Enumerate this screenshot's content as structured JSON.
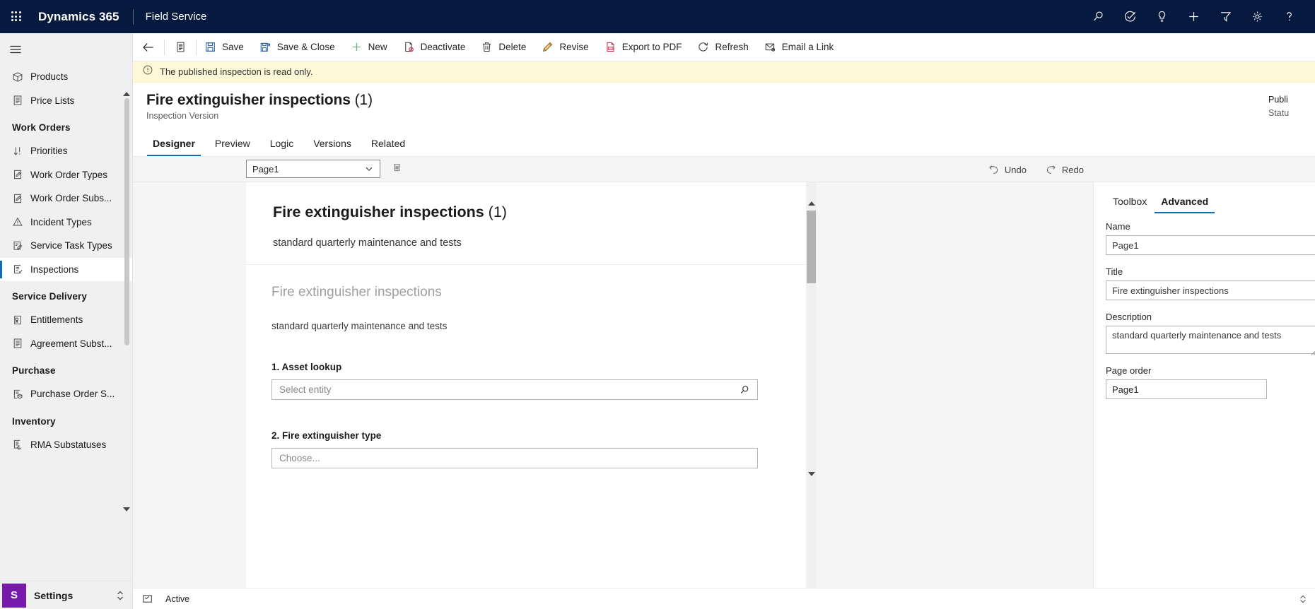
{
  "topnav": {
    "waffle_icon": "waffle-grid-icon",
    "brand": "Dynamics 365",
    "app_name": "Field Service",
    "icons": [
      {
        "name": "search-icon",
        "label": "Search"
      },
      {
        "name": "diagnostics-icon",
        "label": "Diagnostics"
      },
      {
        "name": "lightbulb-icon",
        "label": "Ideas"
      },
      {
        "name": "plus-icon",
        "label": "Quick create"
      },
      {
        "name": "filter-icon",
        "label": "Filter"
      },
      {
        "name": "gear-icon",
        "label": "Settings"
      },
      {
        "name": "help-icon",
        "label": "Help"
      }
    ]
  },
  "sitemap": {
    "hamburger_icon": "hamburger-icon",
    "groups": [
      {
        "title": "",
        "items": [
          {
            "label": "Products",
            "icon": "box-icon",
            "selected": false
          },
          {
            "label": "Price Lists",
            "icon": "pricelist-icon",
            "selected": false
          }
        ]
      },
      {
        "title": "Work Orders",
        "items": [
          {
            "label": "Priorities",
            "icon": "sort-icon",
            "selected": false
          },
          {
            "label": "Work Order Types",
            "icon": "clipboard-pen-icon",
            "selected": false
          },
          {
            "label": "Work Order Subs...",
            "icon": "clipboard-pen-icon",
            "selected": false
          },
          {
            "label": "Incident Types",
            "icon": "warning-triangle-icon",
            "selected": false
          },
          {
            "label": "Service Task Types",
            "icon": "task-pen-icon",
            "selected": false
          },
          {
            "label": "Inspections",
            "icon": "inspection-icon",
            "selected": true
          }
        ]
      },
      {
        "title": "Service Delivery",
        "items": [
          {
            "label": "Entitlements",
            "icon": "entitlement-icon",
            "selected": false
          },
          {
            "label": "Agreement Subst...",
            "icon": "pricelist-icon",
            "selected": false
          }
        ]
      },
      {
        "title": "Purchase",
        "items": [
          {
            "label": "Purchase Order S...",
            "icon": "purchase-order-icon",
            "selected": false
          }
        ]
      },
      {
        "title": "Inventory",
        "items": [
          {
            "label": "RMA Substatuses",
            "icon": "rma-icon",
            "selected": false
          }
        ]
      }
    ],
    "settings": {
      "tile_letter": "S",
      "label": "Settings",
      "chevron_icon": "chevron-updown-icon"
    }
  },
  "commandbar": {
    "back_icon": "arrow-left-icon",
    "form_selector_icon": "form-list-icon",
    "buttons": [
      {
        "label": "Save",
        "icon": "save-icon"
      },
      {
        "label": "Save & Close",
        "icon": "save-close-icon"
      },
      {
        "label": "New",
        "icon": "plus-icon"
      },
      {
        "label": "Deactivate",
        "icon": "deactivate-icon"
      },
      {
        "label": "Delete",
        "icon": "trash-icon"
      },
      {
        "label": "Revise",
        "icon": "pencil-icon"
      },
      {
        "label": "Export to PDF",
        "icon": "pdf-icon"
      },
      {
        "label": "Refresh",
        "icon": "refresh-icon"
      },
      {
        "label": "Email a Link",
        "icon": "email-link-icon"
      }
    ]
  },
  "notification": {
    "icon": "info-circle-icon",
    "text": "The published inspection is read only."
  },
  "record": {
    "title": "Fire extinguisher inspections",
    "title_suffix": "(1)",
    "subtitle": "Inspection Version",
    "header_fields": [
      {
        "label": "Publi",
        "value": "Statu"
      }
    ]
  },
  "tabs": [
    {
      "label": "Designer",
      "active": true
    },
    {
      "label": "Preview",
      "active": false
    },
    {
      "label": "Logic",
      "active": false
    },
    {
      "label": "Versions",
      "active": false
    },
    {
      "label": "Related",
      "active": false
    }
  ],
  "designer": {
    "page_select_value": "Page1",
    "page_select_chevron": "chevron-down-icon",
    "delete_page_icon": "trash-icon",
    "undo": {
      "label": "Undo",
      "icon": "undo-icon"
    },
    "redo": {
      "label": "Redo",
      "icon": "redo-icon"
    },
    "card": {
      "header_title": "Fire extinguisher inspections",
      "header_title_suffix": "(1)",
      "header_subtitle": "standard quarterly maintenance and tests",
      "form_title": "Fire extinguisher inspections",
      "form_subtitle": "standard quarterly maintenance and tests",
      "questions": [
        {
          "number": "1.",
          "label": "Asset lookup",
          "control": "lookup",
          "placeholder": "Select entity",
          "icon": "search-icon"
        },
        {
          "number": "2.",
          "label": "Fire extinguisher type",
          "control": "dropdown",
          "placeholder": "Choose...",
          "icon": ""
        }
      ]
    },
    "scrollbar": {
      "up_icon": "triangle-up-icon",
      "down_icon": "triangle-down-icon"
    }
  },
  "properties": {
    "tabs": [
      {
        "label": "Toolbox",
        "active": false
      },
      {
        "label": "Advanced",
        "active": true
      }
    ],
    "fields": [
      {
        "label": "Name",
        "value": "Page1",
        "type": "input"
      },
      {
        "label": "Title",
        "value": "Fire extinguisher inspections",
        "type": "input"
      },
      {
        "label": "Description",
        "value": "standard quarterly maintenance and tests",
        "type": "textarea"
      },
      {
        "label": "Page order",
        "value": "Page1",
        "type": "input-short"
      }
    ]
  },
  "footer": {
    "icon": "form-footer-icon",
    "status": "Active",
    "right_icon": "expand-icon"
  },
  "colors": {
    "nav_bg": "#06193f",
    "accent": "#0f6cbd",
    "notif_bg": "#fdf8d8",
    "rail_bg": "#f0f0f0",
    "canvas_bg": "#f5f5f5",
    "settings_tile": "#7719aa"
  }
}
